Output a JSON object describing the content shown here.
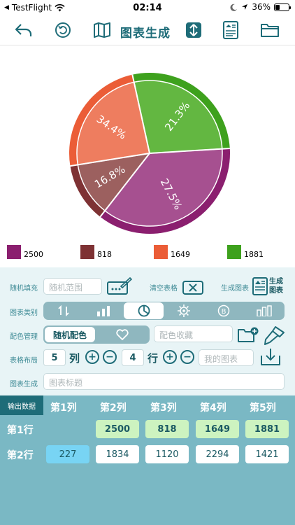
{
  "status": {
    "carrier": "TestFlight",
    "time": "02:14",
    "battery": "36%"
  },
  "toolbar": {
    "title": "图表生成"
  },
  "chart_data": {
    "type": "pie",
    "categories": [
      "2500",
      "818",
      "1649",
      "1881"
    ],
    "values": [
      2500,
      818,
      1649,
      1881
    ],
    "labels": [
      "27.5%",
      "16.8%",
      "34.4%",
      "21.3%"
    ],
    "colors": [
      "#8b1f6f",
      "#7e3234",
      "#eb5d37",
      "#3ea11d"
    ],
    "face_colors": [
      "#a65090",
      "#9c605f",
      "#ee7d5f",
      "#63b741"
    ]
  },
  "controls": {
    "random_fill": {
      "label": "随机填充",
      "placeholder": "随机范围"
    },
    "clear_table": "清空表格",
    "generate_chart": {
      "label": "生成图表",
      "icon_text": "生成 图表"
    },
    "chart_type_label": "图表类别",
    "color_manage": {
      "label": "配色管理",
      "toggle": "随机配色",
      "placeholder": "配色收藏"
    },
    "layout": {
      "label": "表格布局",
      "cols": "5",
      "cols_unit": "列",
      "rows": "4",
      "rows_unit": "行",
      "placeholder": "我的图表"
    },
    "title_row": {
      "label": "图表生成",
      "placeholder": "图表标题"
    }
  },
  "table": {
    "tab": "输出数据",
    "columns": [
      "第1列",
      "第2列",
      "第3列",
      "第4列",
      "第5列"
    ],
    "rows": [
      {
        "label": "第1行",
        "cells": [
          "",
          "2500",
          "818",
          "1649",
          "1881"
        ]
      },
      {
        "label": "第2行",
        "cells": [
          "227",
          "1834",
          "1120",
          "2294",
          "1421"
        ]
      }
    ]
  }
}
